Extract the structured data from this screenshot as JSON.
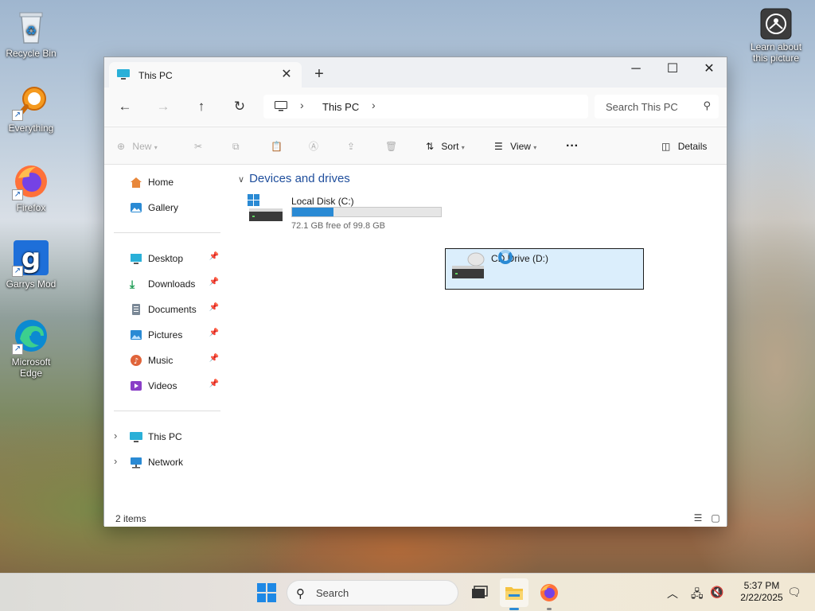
{
  "desktop": {
    "icons": [
      {
        "label": "Recycle Bin",
        "icon": "recycle-bin-icon"
      },
      {
        "label": "Everything",
        "icon": "everything-search-icon"
      },
      {
        "label": "Firefox",
        "icon": "firefox-icon"
      },
      {
        "label": "Garrys Mod",
        "icon": "garrys-mod-icon"
      },
      {
        "label": "Microsoft Edge",
        "icon": "edge-icon"
      }
    ],
    "learn_about": "Learn about this picture"
  },
  "window": {
    "tab_title": "This PC",
    "breadcrumb": "This PC",
    "search_placeholder": "Search This PC",
    "commands": {
      "new": "New",
      "sort": "Sort",
      "view": "View",
      "details": "Details"
    },
    "sidebar": {
      "top": [
        {
          "label": "Home",
          "icon": "home-icon"
        },
        {
          "label": "Gallery",
          "icon": "gallery-icon"
        }
      ],
      "pinned": [
        {
          "label": "Desktop",
          "icon": "desktop-folder-icon"
        },
        {
          "label": "Downloads",
          "icon": "downloads-icon"
        },
        {
          "label": "Documents",
          "icon": "documents-icon"
        },
        {
          "label": "Pictures",
          "icon": "pictures-icon"
        },
        {
          "label": "Music",
          "icon": "music-icon"
        },
        {
          "label": "Videos",
          "icon": "videos-icon"
        }
      ],
      "bottom": [
        {
          "label": "This PC",
          "icon": "this-pc-icon"
        },
        {
          "label": "Network",
          "icon": "network-icon"
        }
      ]
    },
    "group_title": "Devices and drives",
    "drives": [
      {
        "name": "Local Disk (C:)",
        "free_text": "72.1 GB free of 99.8 GB",
        "used_fraction": 0.28
      },
      {
        "name": "CD Drive (D:)"
      }
    ],
    "status": "2 items"
  },
  "taskbar": {
    "search_placeholder": "Search",
    "time": "5:37 PM",
    "date": "2/22/2025"
  },
  "colors": {
    "accent": "#2a8ad4",
    "selection": "#dbeefc",
    "group_heading": "#1f4e9c"
  }
}
